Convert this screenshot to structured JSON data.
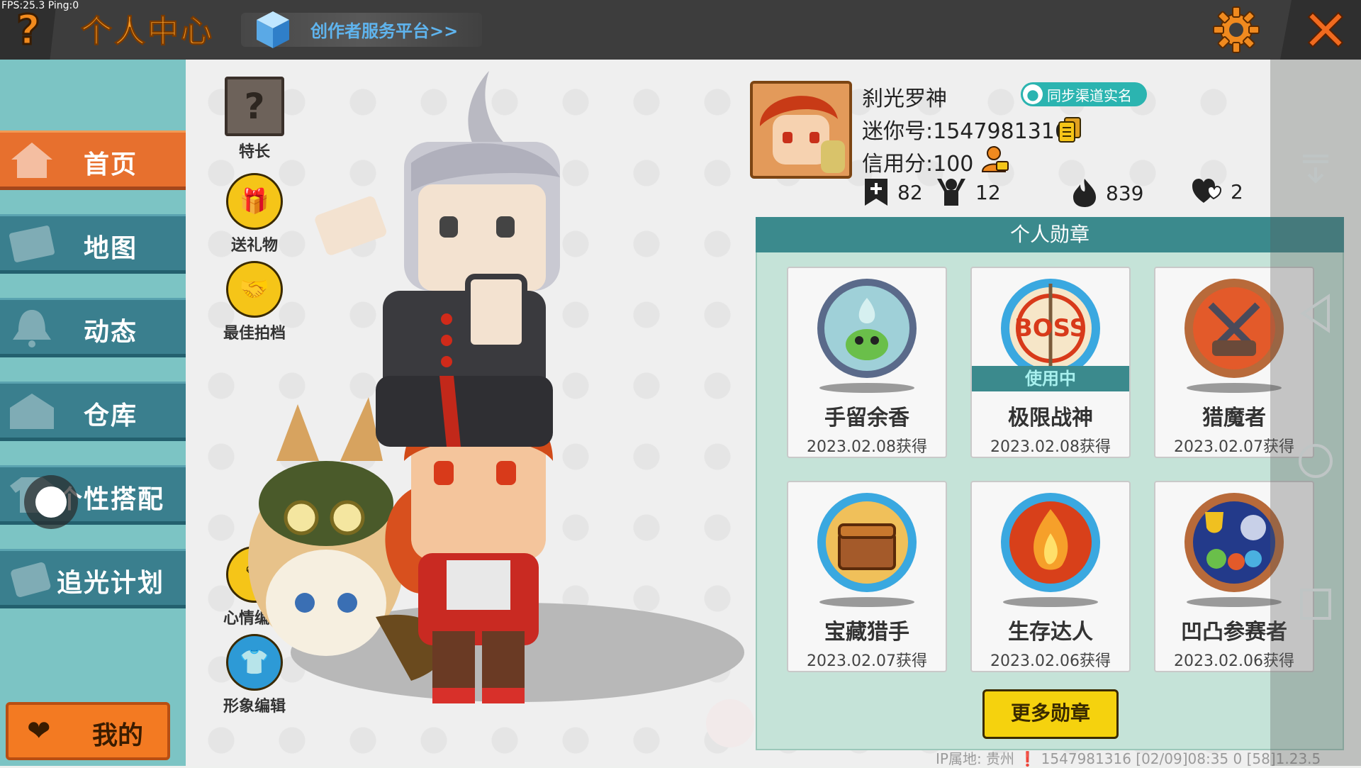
{
  "debug": {
    "fps_text": "FPS:25.3  Ping:0"
  },
  "header": {
    "help_glyph": "?",
    "title": "个人中心",
    "creator_link": "创作者服务平台>>",
    "colors": {
      "bar": "#3d3d3d",
      "accent": "#f79a25",
      "link": "#5fb4ee"
    }
  },
  "sidebar": {
    "items": [
      {
        "label": "首页",
        "icon": "house-icon",
        "active": true
      },
      {
        "label": "地图",
        "icon": "map-icon",
        "active": false
      },
      {
        "label": "动态",
        "icon": "bell-icon",
        "active": false
      },
      {
        "label": "仓库",
        "icon": "warehouse-icon",
        "active": false
      },
      {
        "label": "个性搭配",
        "icon": "shirt-icon",
        "active": false
      },
      {
        "label": "追光计划",
        "icon": "light-plan-icon",
        "active": false
      }
    ],
    "mine_label": "我的"
  },
  "actions": {
    "specialty": "特长",
    "send_gift": "送礼物",
    "best_partner": "最佳拍档",
    "mood_edit": "心情编辑",
    "image_edit": "形象编辑"
  },
  "profile": {
    "name": "刹光罗神",
    "realname_button": "同步渠道实名",
    "mini_id": "迷你号:1547981316",
    "credit": "信用分:100",
    "stats": {
      "plus": "82",
      "fans": "12",
      "popularity": "839",
      "likes": "2"
    }
  },
  "medals": {
    "title": "个人勋章",
    "items": [
      {
        "name": "手留余香",
        "date": "2023.02.08获得",
        "in_use": false
      },
      {
        "name": "极限战神",
        "date": "2023.02.08获得",
        "in_use": true,
        "in_use_label": "使用中"
      },
      {
        "name": "猎魔者",
        "date": "2023.02.07获得",
        "in_use": false
      },
      {
        "name": "宝藏猎手",
        "date": "2023.02.07获得",
        "in_use": false
      },
      {
        "name": "生存达人",
        "date": "2023.02.06获得",
        "in_use": false
      },
      {
        "name": "凹凸参赛者",
        "date": "2023.02.06获得",
        "in_use": false
      }
    ],
    "more_button": "更多勋章"
  },
  "footer": {
    "text": "IP属地: 贵州 ❗   1547981316   [02/09]08:35 0   [58]1.23.5"
  }
}
